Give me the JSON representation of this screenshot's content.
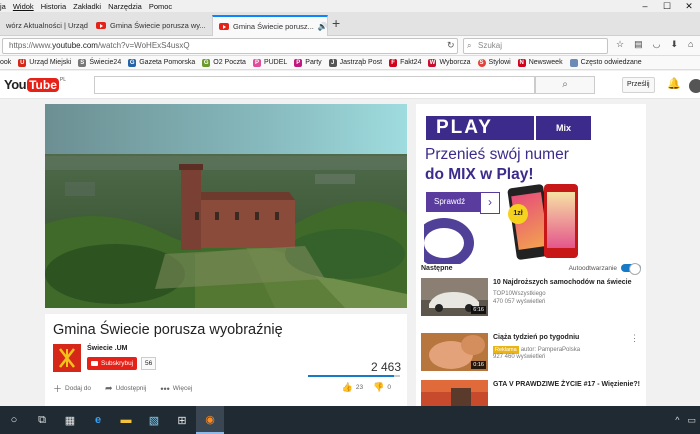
{
  "menubar": {
    "items": [
      "ja",
      "Widok",
      "Historia",
      "Zakładki",
      "Narzędzia",
      "Pomoc"
    ]
  },
  "tabs": [
    {
      "label": "wórz Aktualności | Urząd..."
    },
    {
      "label": "Gmina Świecie porusza wy..."
    },
    {
      "label": "Gmina Świecie porusz..."
    }
  ],
  "nav": {
    "url_host": "https://www.",
    "url_domain": "youtube.com",
    "url_path": "/watch?v=WoHExS4usxQ",
    "search_placeholder": "Szukaj"
  },
  "bookmarks": [
    {
      "label": "ook",
      "color": "#888888",
      "glyph": ""
    },
    {
      "label": "Urząd Miejski",
      "color": "#d62818",
      "glyph": "U"
    },
    {
      "label": "Świecie24",
      "color": "#777777",
      "glyph": "Ś"
    },
    {
      "label": "Gazeta Pomorska",
      "color": "#2563a8",
      "glyph": "G"
    },
    {
      "label": "O2 Poczta",
      "color": "#6b9b2a",
      "glyph": "G"
    },
    {
      "label": "PUDEL",
      "color": "#e34b9b",
      "glyph": "P"
    },
    {
      "label": "Party",
      "color": "#c2177e",
      "glyph": "P"
    },
    {
      "label": "Jastrząb Post",
      "color": "#555555",
      "glyph": "J"
    },
    {
      "label": "Fakt24",
      "color": "#d0021b",
      "glyph": "F"
    },
    {
      "label": "Wyborcza",
      "color": "#c8102e",
      "glyph": "W"
    },
    {
      "label": "Stylowi",
      "color": "#e0443a",
      "glyph": "S"
    },
    {
      "label": "Newsweek",
      "color": "#d0021b",
      "glyph": "N"
    },
    {
      "label": "Często odwiedzane",
      "color": "#6a8bb5",
      "glyph": ""
    }
  ],
  "youtube": {
    "logo_you": "You",
    "logo_tube": "Tube",
    "logo_region": "PL",
    "upload_label": "Prześlij"
  },
  "video": {
    "title": "Gmina Świecie porusza wyobraźnię",
    "channel": "Świecie .UM",
    "subscribe_label": "Subskrybuj",
    "subscriber_count": "56",
    "views": "2 463",
    "views_fill_fraction": 0.93,
    "actions": {
      "add": "Dodaj do",
      "share": "Udostępnij",
      "more": "Więcej",
      "likes": "23",
      "dislikes": "0"
    }
  },
  "ad": {
    "brand": "PLAY",
    "tag": "Mix",
    "line1": "Przenieś swój numer",
    "line2": "do MIX w Play!",
    "cta": "Sprawdź",
    "price_top": "tylko za",
    "price": "1zł"
  },
  "sidebar": {
    "next_label": "Następne",
    "autoplay_label": "Autoodtwarzanie",
    "items": [
      {
        "title": "10 Najdroższych samochodów na świecie",
        "channel": "TOP10Wszystkiego",
        "views": "470 057 wyświetleń",
        "duration": "6:16",
        "badge": ""
      },
      {
        "title": "Ciąża tydzień po tygodniu",
        "channel": "autor: PamperaPolska",
        "views": "927 460 wyświetleń",
        "duration": "0:16",
        "badge": "Reklama"
      },
      {
        "title": "GTA V PRAWDZIWE ŻYCIE #17 - Więzienie?!",
        "channel": "",
        "views": "",
        "duration": "",
        "badge": ""
      }
    ]
  },
  "colors": {
    "yt_red": "#e62117",
    "play_purple": "#3d2b8c",
    "firefox_accent": "#0a84ff",
    "taskbar": "#1f2a33"
  }
}
